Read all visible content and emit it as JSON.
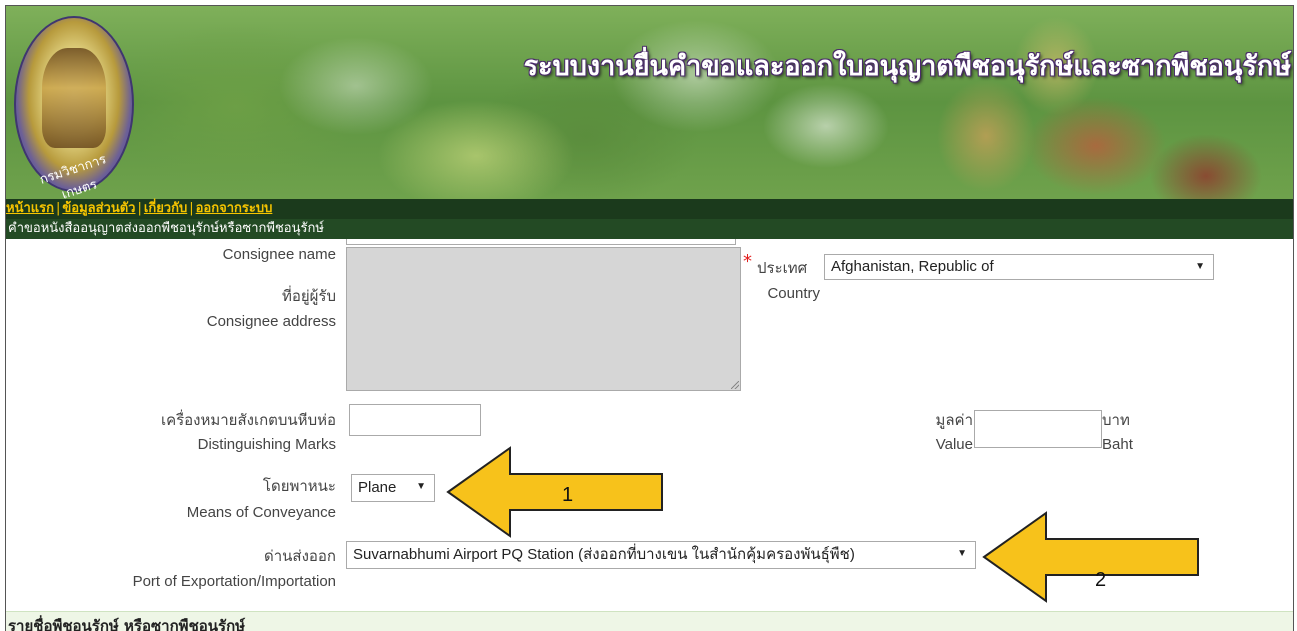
{
  "banner": {
    "title": "ระบบงานยื่นคำขอและออกใบอนุญาตพืชอนุรักษ์และซากพืชอนุรักษ์",
    "seal_text": "กรมวิชาการเกษตร"
  },
  "nav": {
    "items": [
      {
        "label": "หน้าแรก"
      },
      {
        "label": "ข้อมูลส่วนตัว"
      },
      {
        "label": "เกี่ยวกับ"
      },
      {
        "label": "ออกจากระบบ"
      }
    ],
    "separator": "|"
  },
  "page": {
    "subtitle": "คำขอหนังสืออนุญาตส่งออกพืชอนุรักษ์หรือซากพืชอนุรักษ์"
  },
  "form": {
    "consignee_name_label": "Consignee name",
    "address_label_th": "ที่อยู่ผู้รับ",
    "address_label_en": "Consignee address",
    "address_value": "",
    "country_required": "*",
    "country_label_th": "ประเทศ",
    "country_label_en": "Country",
    "country_value": "Afghanistan, Republic of",
    "marks_label_th": "เครื่องหมายสังเกตบนหีบห่อ",
    "marks_label_en": "Distinguishing Marks",
    "value_label_th": "มูลค่า",
    "value_label_en": "Value",
    "currency_th": "บาท",
    "currency_en": "Baht",
    "conveyance_label_th": "โดยพาหนะ",
    "conveyance_label_en": "Means of Conveyance",
    "conveyance_value": "Plane",
    "port_label_th": "ด่านส่งออก",
    "port_label_en": "Port of Exportation/Importation",
    "port_value": "Suvarnabhumi Airport PQ Station (ส่งออกที่บางเขน ในสำนักคุ้มครองพันธุ์พืช)"
  },
  "section": {
    "title": "รายชื่อพืชอนุรักษ์ หรือซากพืชอนุรักษ์"
  },
  "annotations": {
    "arrow1_number": "1",
    "arrow2_number": "2",
    "arrow_color": "#f7c21b"
  },
  "colors": {
    "nav_bg": "#1b3a1c",
    "nav_link": "#f5c400",
    "subtitle_bg": "#234a24"
  }
}
